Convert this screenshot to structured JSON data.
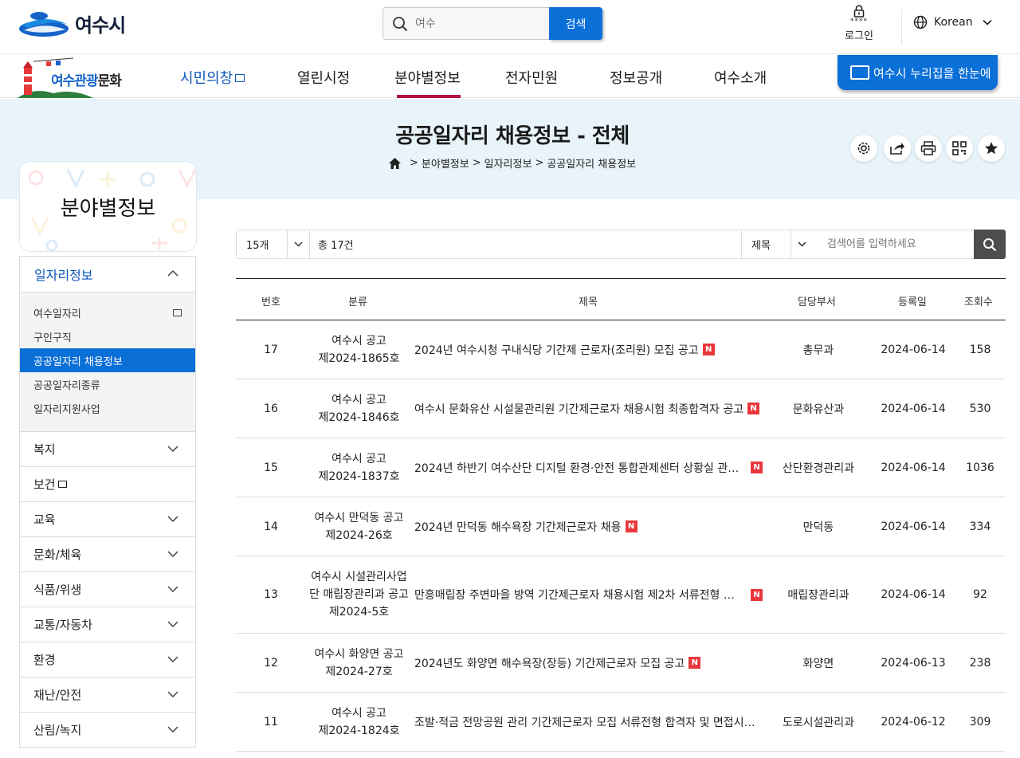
{
  "header": {
    "logo_text": "여수시",
    "search_placeholder": "여수",
    "search_button": "검색",
    "login_stars": "****",
    "login_label": "로그인",
    "language": "Korean"
  },
  "gnb": {
    "tour_logo_blue": "여수관광",
    "tour_logo_dark": "문화",
    "items": [
      {
        "label": "시민의창"
      },
      {
        "label": "열린시정"
      },
      {
        "label": "분야별정보"
      },
      {
        "label": "전자민원"
      },
      {
        "label": "정보공개"
      },
      {
        "label": "여수소개"
      }
    ],
    "nurijip_label": "여수시 누리집을 한눈에",
    "active_item": "분야별정보"
  },
  "page": {
    "title": "공공일자리 채용정보 - 전체",
    "breadcrumb": [
      "분야별정보",
      "일자리정보",
      "공공일자리 채용정보"
    ],
    "breadcrumb_sep": ">"
  },
  "sidebar": {
    "title": "분야별정보",
    "open_group": "일자리정보",
    "sub_items": [
      {
        "label": "여수일자리"
      },
      {
        "label": "구인구직"
      },
      {
        "label": "공공일자리 채용정보"
      },
      {
        "label": "공공일자리종류"
      },
      {
        "label": "일자리지원사업"
      }
    ],
    "active_sub": "공공일자리 채용정보",
    "groups": [
      {
        "label": "복지"
      },
      {
        "label": "보건"
      },
      {
        "label": "교육"
      },
      {
        "label": "문화/체육"
      },
      {
        "label": "식품/위생"
      },
      {
        "label": "교통/자동차"
      },
      {
        "label": "환경"
      },
      {
        "label": "재난/안전"
      },
      {
        "label": "산림/녹지"
      }
    ]
  },
  "filter": {
    "page_size": "15개",
    "total": "총 17건",
    "field": "제목",
    "search_placeholder": "검색어를 입력하세요"
  },
  "table": {
    "headers": {
      "no": "번호",
      "category": "분류",
      "title": "제목",
      "dept": "담당부서",
      "date": "등록일",
      "views": "조회수"
    },
    "new_badge": "N",
    "rows": [
      {
        "no": "17",
        "cat1": "여수시 공고",
        "cat2": "제2024-1865호",
        "cat3": "",
        "title": "2024년 여수시청 구내식당 기간제 근로자(조리원) 모집 공고",
        "new": true,
        "dept": "총무과",
        "date": "2024-06-14",
        "views": "158"
      },
      {
        "no": "16",
        "cat1": "여수시 공고",
        "cat2": "제2024-1846호",
        "cat3": "",
        "title": "여수시 문화유산 시설물관리원 기간제근로자 채용시험 최종합격자 공고",
        "new": true,
        "dept": "문화유산과",
        "date": "2024-06-14",
        "views": "530"
      },
      {
        "no": "15",
        "cat1": "여수시 공고",
        "cat2": "제2024-1837호",
        "cat3": "",
        "title": "2024년 하반기 여수산단 디지털 환경·안전 통합관제센터 상황실 관제…",
        "new": true,
        "dept": "산단환경관리과",
        "date": "2024-06-14",
        "views": "1036"
      },
      {
        "no": "14",
        "cat1": "여수시 만덕동 공고",
        "cat2": "제2024-26호",
        "cat3": "",
        "title": "2024년 만덕동 해수욕장 기간제근로자 채용",
        "new": true,
        "dept": "만덕동",
        "date": "2024-06-14",
        "views": "334"
      },
      {
        "no": "13",
        "cat1": "여수시 시설관리사업",
        "cat2": "단 매립장관리과 공고",
        "cat3": "제2024-5호",
        "title": "만흥매립장 주변마을 방역 기간제근로자 채용시험 제2차 서류전형 합격…",
        "new": true,
        "dept": "매립장관리과",
        "date": "2024-06-14",
        "views": "92"
      },
      {
        "no": "12",
        "cat1": "여수시 화양면 공고",
        "cat2": "제2024-27호",
        "cat3": "",
        "title": "2024년도 화양면 해수욕장(장등) 기간제근로자 모집 공고",
        "new": true,
        "dept": "화양면",
        "date": "2024-06-13",
        "views": "238"
      },
      {
        "no": "11",
        "cat1": "여수시 공고",
        "cat2": "제2024-1824호",
        "cat3": "",
        "title": "조발·적금 전망공원 관리 기간제근로자 모집 서류전형 합격자 및 면접시험 …",
        "new": false,
        "dept": "도로시설관리과",
        "date": "2024-06-12",
        "views": "309"
      }
    ]
  },
  "colors": {
    "primary_blue": "#0b6fd8",
    "active_menu_bar": "#b5123d",
    "title_band": "#e8f3fa",
    "new_badge": "#e8383d"
  }
}
